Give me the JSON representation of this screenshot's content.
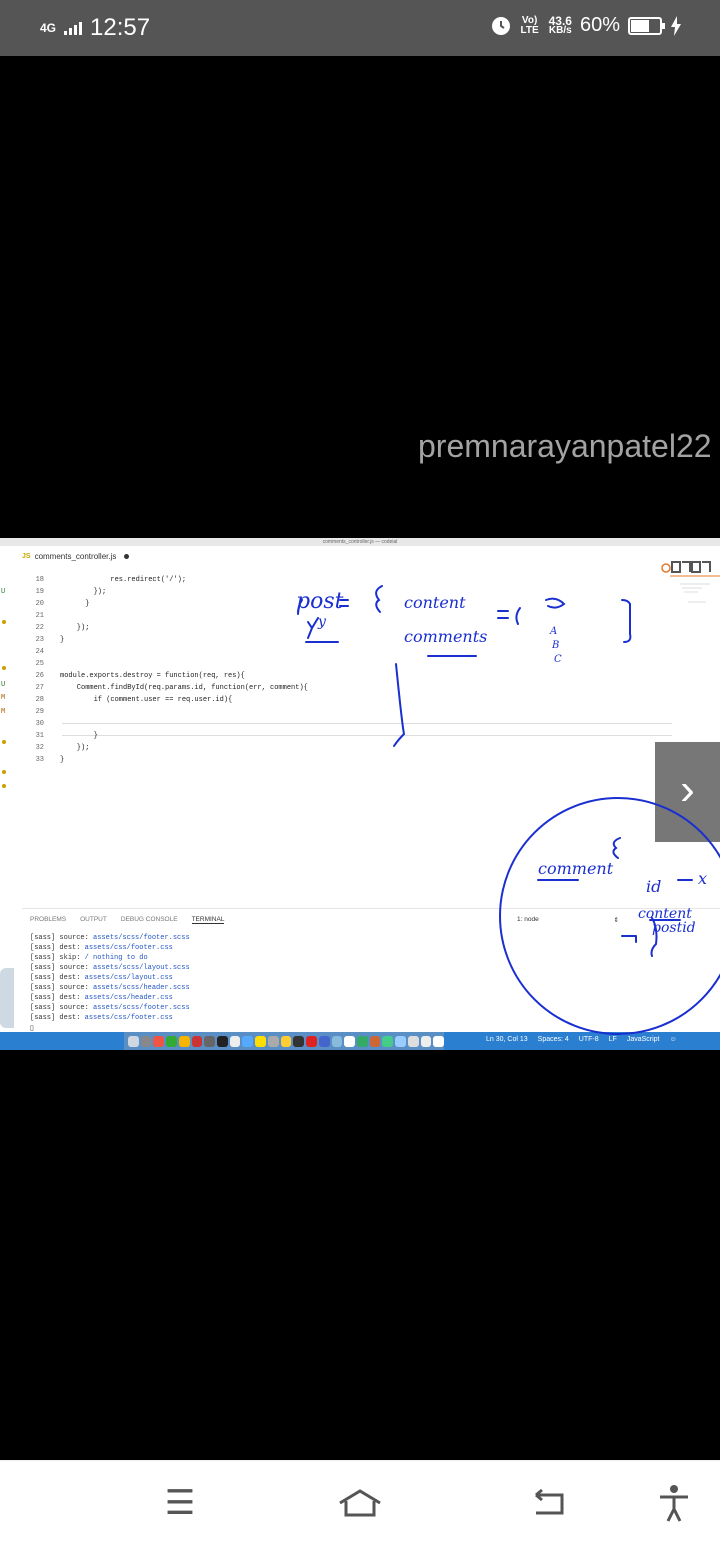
{
  "statusbar": {
    "network": "4G",
    "time": "12:57",
    "volte": "Vo) LTE",
    "speed_value": "43.6",
    "speed_unit": "KB/s",
    "battery": "60%"
  },
  "watermark": "premnarayanpatel22",
  "editor": {
    "window_title": "comments_controller.js — codeial",
    "tab_label": "comments_controller.js",
    "gutter_badges": [
      "U",
      "U",
      "M",
      "M"
    ],
    "lines": [
      {
        "n": "18",
        "text": "            res.redirect('/');"
      },
      {
        "n": "19",
        "text": "        });"
      },
      {
        "n": "20",
        "text": "      }"
      },
      {
        "n": "21",
        "text": ""
      },
      {
        "n": "22",
        "text": "    });"
      },
      {
        "n": "23",
        "text": "}"
      },
      {
        "n": "24",
        "text": ""
      },
      {
        "n": "25",
        "text": ""
      },
      {
        "n": "26",
        "text": "module.exports.destroy = function(req, res){"
      },
      {
        "n": "27",
        "text": "    Comment.findById(req.params.id, function(err, comment){"
      },
      {
        "n": "28",
        "text": "        if (comment.user == req.user.id){"
      },
      {
        "n": "29",
        "text": ""
      },
      {
        "n": "30",
        "text": ""
      },
      {
        "n": "31",
        "text": "        }"
      },
      {
        "n": "32",
        "text": "    });"
      },
      {
        "n": "33",
        "text": "}"
      }
    ]
  },
  "panel": {
    "tabs": [
      "PROBLEMS",
      "OUTPUT",
      "DEBUG CONSOLE",
      "TERMINAL"
    ],
    "terminal_select": "1: node",
    "terminal_lines": [
      {
        "tag": "[sass]",
        "key": "source:",
        "val": "assets/scss/footer.scss"
      },
      {
        "tag": "[sass]",
        "key": "dest:",
        "val": "assets/css/footer.css"
      },
      {
        "tag": "[sass]",
        "key": "skip:",
        "val": "/ nothing to do"
      },
      {
        "tag": "[sass]",
        "key": "source:",
        "val": "assets/scss/layout.scss"
      },
      {
        "tag": "[sass]",
        "key": "dest:",
        "val": "assets/css/layout.css"
      },
      {
        "tag": "[sass]",
        "key": "source:",
        "val": "assets/scss/header.scss"
      },
      {
        "tag": "[sass]",
        "key": "dest:",
        "val": "assets/css/header.css"
      },
      {
        "tag": "[sass]",
        "key": "source:",
        "val": "assets/scss/footer.scss"
      },
      {
        "tag": "[sass]",
        "key": "dest:",
        "val": "assets/css/footer.css"
      }
    ]
  },
  "statusline": {
    "position": "Ln 30, Col 13",
    "spaces": "Spaces: 4",
    "encoding": "UTF-8",
    "eol": "LF",
    "language": "JavaScript"
  },
  "handwriting": {
    "post": "post",
    "y": "y",
    "content": "content",
    "comments": "comments",
    "items": [
      "A",
      "B",
      "C"
    ],
    "comment": "comment",
    "id": "id",
    "x": "x",
    "content2": "content",
    "postid": "postid"
  },
  "colors": {
    "ink": "#1a2fd0",
    "statusbar": "#555555",
    "vscode_status": "#2a7fd0"
  },
  "icons": {
    "next": "chevron-right-icon",
    "nav_menu": "menu-icon",
    "nav_home": "home-icon",
    "nav_back": "back-icon",
    "nav_accessibility": "accessibility-icon"
  }
}
